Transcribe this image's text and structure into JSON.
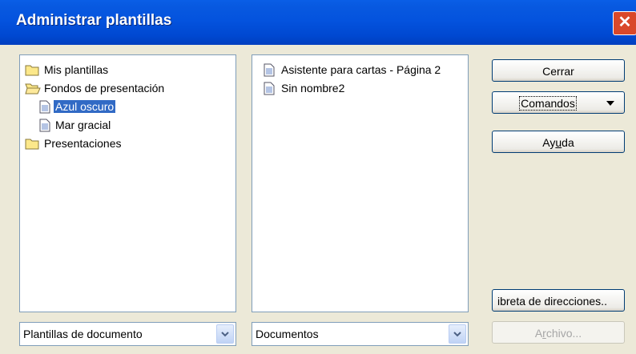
{
  "window": {
    "title": "Administrar plantillas",
    "close_glyph": "✕"
  },
  "left_tree": {
    "items": [
      {
        "label": "Mis plantillas",
        "icon": "folder-icon"
      },
      {
        "label": "Fondos de presentación",
        "icon": "open-folder-icon"
      },
      {
        "label": "Azul oscuro",
        "icon": "document-icon",
        "selected": true
      },
      {
        "label": "Mar gracial",
        "icon": "document-icon"
      },
      {
        "label": "Presentaciones",
        "icon": "folder-icon"
      }
    ]
  },
  "right_list": {
    "items": [
      {
        "label": "Asistente para cartas - Página 2",
        "icon": "document-icon"
      },
      {
        "label": "Sin nombre2",
        "icon": "document-icon"
      }
    ]
  },
  "buttons": {
    "close_label": "Cerrar",
    "commands_label": "Comandos",
    "help_pre": "Ay",
    "help_u": "u",
    "help_post": "da",
    "address_book_label": "ibreta de direcciones..",
    "file_pre": "A",
    "file_u": "r",
    "file_post": "chivo..."
  },
  "combos": {
    "left_value": "Plantillas de documento",
    "right_value": "Documentos"
  },
  "colors": {
    "title_bar": "#0453de",
    "selection": "#316ac5",
    "close": "#d9482a",
    "dialog_bg": "#ece9d8"
  }
}
